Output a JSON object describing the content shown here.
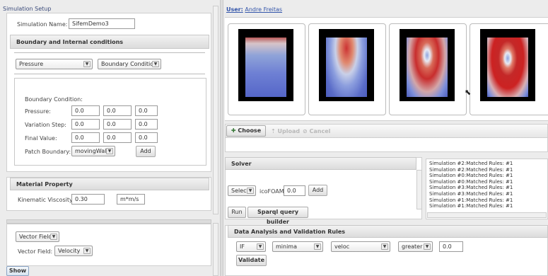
{
  "setup": {
    "title": "Simulation Setup",
    "name_label": "Simulation Name:",
    "name_value": "SifemDemo3"
  },
  "boundary": {
    "header": "Boundary and Internal conditions",
    "type_select": "Pressure",
    "mode_select": "Boundary Condition",
    "section_label": "Boundary Condition:",
    "rows": [
      {
        "label": "Pressure:",
        "v1": "0.0",
        "v2": "0.0",
        "v3": "0.0"
      },
      {
        "label": "Variation Step:",
        "v1": "0.0",
        "v2": "0.0",
        "v3": "0.0"
      },
      {
        "label": "Final Value:",
        "v1": "0.0",
        "v2": "0.0",
        "v3": "0.0"
      }
    ],
    "patch_label": "Patch Boundary:",
    "patch_value": "movingWall",
    "add_label": "Add"
  },
  "material": {
    "header": "Material Property",
    "viscosity_label": "Kinematic Viscosity",
    "viscosity_value": "0.30",
    "unit_value": "m*m/s"
  },
  "output": {
    "type_select": "Vector Field",
    "field_label": "Vector Field:",
    "field_value": "Velocity",
    "show_label": "Show"
  },
  "user": {
    "prefix": "User:",
    "name": "Andre Freitas"
  },
  "upload": {
    "choose_label": "Choose",
    "upload_label": "Upload",
    "cancel_label": "Cancel"
  },
  "solver": {
    "header": "Solver",
    "select_label": "Select",
    "solver_name": "icoFOAM",
    "solver_value": "0.0",
    "add_label": "Add",
    "run_label": "Run",
    "sparql_label": "Sparql query builder"
  },
  "log": [
    "Simulation #2:Matched Rules: #1",
    "Simulation #2:Matched Rules: #1",
    "Simulation #0:Matched Rules: #1",
    "Simulation #0:Matched Rules: #1",
    "Simulation #3:Matched Rules: #1",
    "Simulation #3:Matched Rules: #1",
    "Simulation #1:Matched Rules: #1",
    "Simulation #1:Matched Rules: #1"
  ],
  "analysis": {
    "header": "Data Analysis and Validation Rules",
    "cond": "IF",
    "func": "minima",
    "var": "veloc",
    "op": "greater",
    "value": "0.0",
    "validate_label": "Validate"
  },
  "colors": {
    "accent_link": "#3355aa",
    "field_high": "#c0262a",
    "field_low": "#4a5fc8",
    "field_mid": "#e8eaf2"
  },
  "icons": [
    "plus-icon",
    "upload-icon",
    "cancel-icon",
    "chevron-down-icon",
    "mouse-cursor-icon"
  ]
}
